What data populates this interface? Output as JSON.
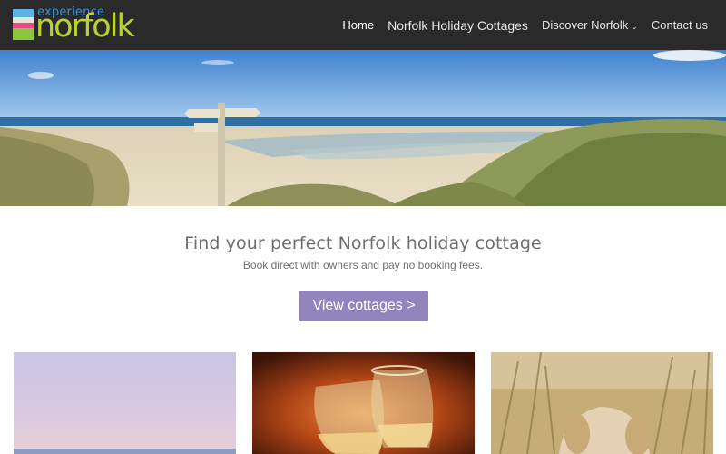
{
  "brand": {
    "logo_small": "experience",
    "logo_big": "norfolk",
    "colors": {
      "header_bg": "#2a2a2a",
      "logo_green": "#b9d22f",
      "logo_blue": "#3b8fd0",
      "accent": "#9284bd"
    }
  },
  "nav": {
    "items": [
      {
        "label": "Home",
        "active": true
      },
      {
        "label": "Norfolk Holiday Cottages"
      },
      {
        "label": "Discover Norfolk",
        "icon": "chevron-down-icon"
      },
      {
        "label": "Contact us"
      }
    ]
  },
  "hero": {
    "image": "beach-signpost-dunes-photo"
  },
  "intro": {
    "title": "Find your perfect Norfolk holiday cottage",
    "subtitle": "Book direct with owners and pay no booking fees.",
    "cta_label": "View cottages >"
  },
  "cards": [
    {
      "image": "beach-sunset-photo"
    },
    {
      "image": "wine-glasses-fireside-photo"
    },
    {
      "image": "dog-in-dunes-photo"
    }
  ]
}
